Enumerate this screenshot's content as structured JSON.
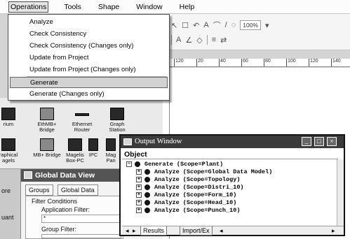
{
  "menubar": {
    "items": [
      {
        "label": "Operations",
        "active": true
      },
      {
        "label": "Tools",
        "active": false
      },
      {
        "label": "Shape",
        "active": false
      },
      {
        "label": "Window",
        "active": false
      },
      {
        "label": "Help",
        "active": false
      }
    ]
  },
  "toolbar": {
    "zoom_value": "100%",
    "glyphs_row1": [
      "↖",
      "☐",
      "↶",
      "·",
      "A",
      "·",
      "⌒",
      "·",
      "/",
      "·",
      "◌",
      "·"
    ],
    "glyphs_row2": [
      "A",
      "·",
      "∠",
      "·",
      "◇",
      "·",
      "≡",
      "·",
      "⇄",
      "·"
    ]
  },
  "operations_menu": {
    "items": [
      {
        "label": "Analyze",
        "highlighted": false
      },
      {
        "label": "Check Consistency",
        "highlighted": false
      },
      {
        "label": "Check Consistency (Changes only)",
        "highlighted": false
      },
      {
        "label": "Update from Project",
        "highlighted": false
      },
      {
        "label": "Update from Project (Changes only)",
        "highlighted": false
      },
      {
        "label": "Generate",
        "highlighted": true
      },
      {
        "label": "Generate (Changes only)",
        "highlighted": false
      }
    ]
  },
  "ruler": {
    "ticks": [
      "120",
      "20",
      "40",
      "60",
      "80",
      "100",
      "120",
      "140"
    ]
  },
  "palette": {
    "items_row1": [
      {
        "label": "rium",
        "icon": "device-icon"
      },
      {
        "label": "EthMB+ Bridge",
        "icon": "bridge-icon"
      },
      {
        "label": "Ethernet Router",
        "icon": "router-icon"
      },
      {
        "label": "Graph Station",
        "icon": "station-icon"
      }
    ],
    "items_row2": [
      {
        "label": "raphical agels",
        "icon": "device-icon"
      },
      {
        "label": "MB+ Bridge",
        "icon": "bridge-icon"
      },
      {
        "label": "Magelis Box-PC",
        "icon": "box-pc-icon"
      },
      {
        "label": "IPC",
        "icon": "ipc-icon"
      },
      {
        "label": "Mag Pan",
        "icon": "panel-icon"
      }
    ]
  },
  "global_data_view": {
    "title": "Global Data View",
    "side_label": "ore",
    "side_label2": "uant",
    "tabs": [
      "Groups",
      "Global Data"
    ],
    "active_tab": "Global Data",
    "group_label": "Filter Conditions",
    "app_filter_label": "Application Filter:",
    "app_filter_value": "*",
    "group_filter_label": "Group Filter:"
  },
  "output_window": {
    "title": "Output Window",
    "column_header": "Object",
    "root": "Generate (Scope=Plant)",
    "children": [
      "Analyze (Scope=Global Data Model)",
      "Analyze (Scope=Topology)",
      "Analyze (Scope=Distri_10)",
      "Analyze (Scope=Form_10)",
      "Analyze (Scope=Head_10)",
      "Analyze (Scope=Punch_10)"
    ],
    "tabs": [
      "Results",
      "Import/Ex"
    ],
    "minimize": "_",
    "maximize": "□",
    "close": "×"
  }
}
